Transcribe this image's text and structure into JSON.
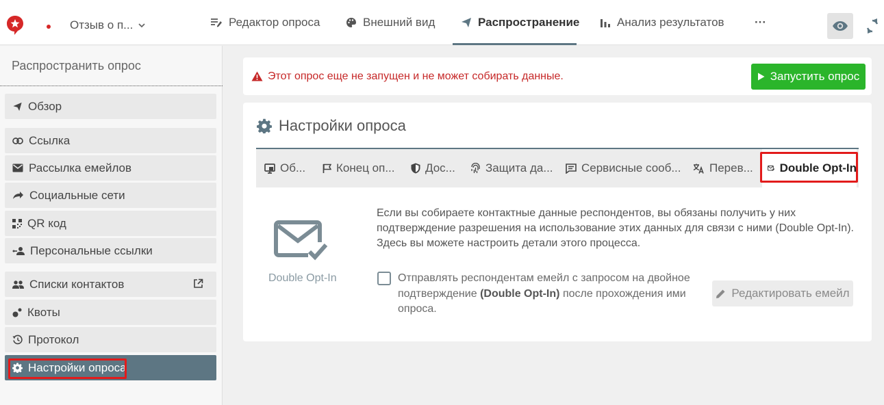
{
  "header": {
    "survey_name": "Отзыв о п...",
    "nav": [
      {
        "label": "Редактор опроса",
        "icon": "edit-list-icon"
      },
      {
        "label": "Внешний вид",
        "icon": "palette-icon"
      },
      {
        "label": "Распространение",
        "icon": "send-icon"
      },
      {
        "label": "Анализ результатов",
        "icon": "bar-chart-icon"
      }
    ],
    "more_label": "···",
    "active_nav": "Распространение"
  },
  "sidebar": {
    "title": "Распространить опрос",
    "items": [
      {
        "label": "Обзор",
        "icon": "send-icon"
      },
      {
        "label": "Ссылка",
        "icon": "link-icon"
      },
      {
        "label": "Рассылка емейлов",
        "icon": "mail-icon"
      },
      {
        "label": "Социальные сети",
        "icon": "share-icon"
      },
      {
        "label": "QR код",
        "icon": "qr-code-icon"
      },
      {
        "label": "Персональные ссылки",
        "icon": "person-link-icon"
      },
      {
        "label": "Списки контактов",
        "icon": "contacts-icon"
      },
      {
        "label": "Квоты",
        "icon": "quota-icon"
      },
      {
        "label": "Протокол",
        "icon": "history-icon"
      },
      {
        "label": "Настройки опроса",
        "icon": "gear-icon"
      }
    ],
    "active_item": "Настройки опроса"
  },
  "alert": {
    "text": "Этот опрос еще не запущен и не может собирать данные.",
    "launch_label": "Запустить опрос"
  },
  "settings": {
    "title": "Настройки опроса",
    "tabs": [
      {
        "label": "Об...",
        "icon": "monitor-icon"
      },
      {
        "label": "Конец оп...",
        "icon": "flag-icon"
      },
      {
        "label": "Дос...",
        "icon": "shield-icon"
      },
      {
        "label": "Защита да...",
        "icon": "fingerprint-icon"
      },
      {
        "label": "Сервисные сооб...",
        "icon": "message-icon"
      },
      {
        "label": "Перев...",
        "icon": "translate-icon"
      },
      {
        "label": "Double Opt-In",
        "icon": "mail-check-icon"
      }
    ],
    "active_tab": "Double Opt-In",
    "feature_label": "Double Opt-In",
    "description": "Если вы собираете контактные данные респондентов, вы обязаны получить у них подтверждение разрешения на использование этих данных для связи с ними (Double Opt-In). Здесь вы можете настроить детали этого процесса.",
    "checkbox": {
      "checked": false,
      "label_before": "Отправлять респондентам емейл с запросом на двойное подтверждение",
      "label_bold": "(Double Opt-In)",
      "label_after": "после прохождения ими опроса."
    },
    "edit_email_label": "Редактировать емейл"
  },
  "colors": {
    "accent": "#5d7683",
    "launch": "#2bb52b",
    "alert_text": "#c62828",
    "highlight": "#e21b1b"
  }
}
